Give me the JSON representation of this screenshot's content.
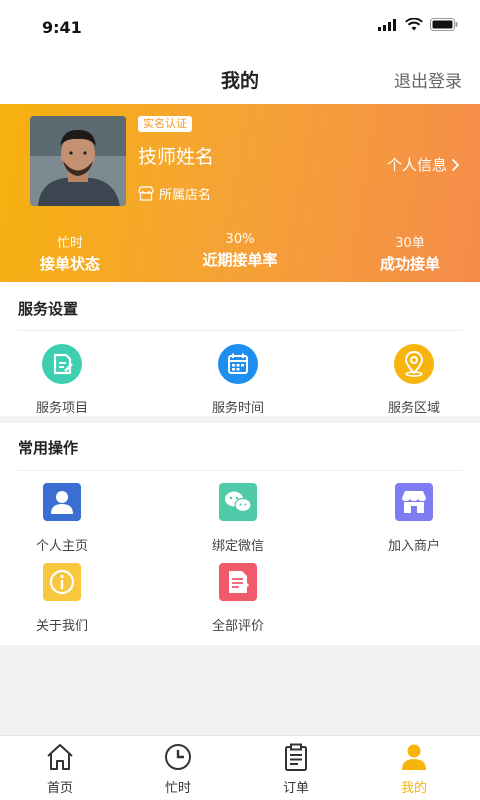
{
  "status_bar": {
    "time": "9:41"
  },
  "nav": {
    "title": "我的",
    "logout": "退出登录"
  },
  "profile": {
    "badge": "实名认证",
    "name": "技师姓名",
    "store": "所属店名",
    "personal_info": "个人信息",
    "stats": [
      {
        "value": "忙时",
        "label": "接单状态"
      },
      {
        "value": "30%",
        "label": "近期接单率"
      },
      {
        "value": "30单",
        "label": "成功接单"
      }
    ]
  },
  "service_settings": {
    "title": "服务设置",
    "items": [
      {
        "label": "服务项目",
        "icon": "edit-icon"
      },
      {
        "label": "服务时间",
        "icon": "calendar-icon"
      },
      {
        "label": "服务区域",
        "icon": "location-icon"
      }
    ]
  },
  "common_ops": {
    "title": "常用操作",
    "items": [
      {
        "label": "个人主页",
        "icon": "user-icon"
      },
      {
        "label": "绑定微信",
        "icon": "wechat-icon"
      },
      {
        "label": "加入商户",
        "icon": "store-icon"
      },
      {
        "label": "关于我们",
        "icon": "info-icon"
      },
      {
        "label": "全部评价",
        "icon": "review-icon"
      }
    ]
  },
  "tabbar": {
    "items": [
      {
        "label": "首页",
        "icon": "home-icon"
      },
      {
        "label": "忙时",
        "icon": "clock-icon"
      },
      {
        "label": "订单",
        "icon": "clipboard-icon"
      },
      {
        "label": "我的",
        "icon": "person-icon"
      }
    ],
    "active_index": 3
  },
  "colors": {
    "accent": "#f7b40c",
    "gradient_start": "#f6b10e",
    "gradient_end": "#f58c4a",
    "teal": "#3ccfb0",
    "blue": "#1e8ff0",
    "amber": "#f6b40c",
    "indigo": "#3a6fd1",
    "mint": "#4fc9a8",
    "purple": "#7e7cf2",
    "yellow": "#f8c73d",
    "red": "#f05a6a"
  }
}
